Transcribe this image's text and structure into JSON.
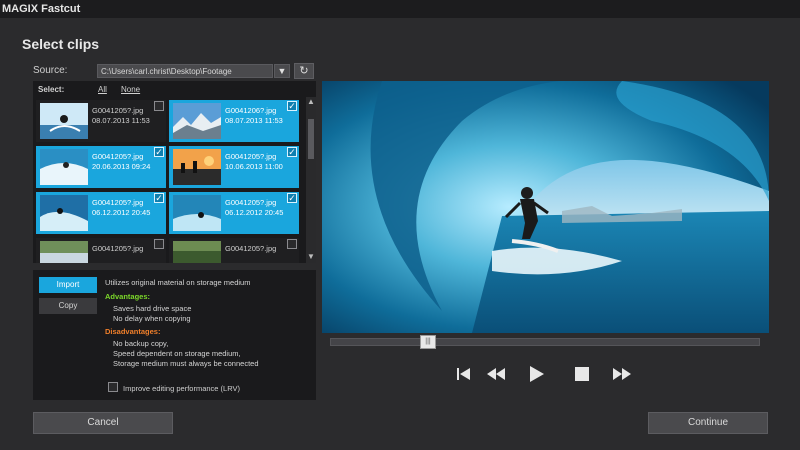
{
  "app": {
    "title": "MAGIX Fastcut"
  },
  "heading": "Select clips",
  "source": {
    "label": "Source:",
    "path": "C:\\Users\\carl.christ\\Desktop\\Footage",
    "dropdown_icon": "chevron-down-icon",
    "refresh_icon": "refresh-icon"
  },
  "select": {
    "label": "Select:",
    "all": "All",
    "none": "None"
  },
  "clips": [
    {
      "name": "G0041205?.jpg",
      "date": "08.07.2013 11:53",
      "selected": false
    },
    {
      "name": "G0041206?.jpg",
      "date": "08.07.2013 11:53",
      "selected": true
    },
    {
      "name": "G0041205?.jpg",
      "date": "20.06.2013 09:24",
      "selected": true
    },
    {
      "name": "G0041205?.jpg",
      "date": "10.06.2013 11:00",
      "selected": true
    },
    {
      "name": "G0041205?.jpg",
      "date": "06.12.2012 20:45",
      "selected": true
    },
    {
      "name": "G0041205?.jpg",
      "date": "06.12.2012 20:45",
      "selected": true
    },
    {
      "name": "G0041205?.jpg",
      "date": "",
      "selected": false
    },
    {
      "name": "G0041205?.jpg",
      "date": "",
      "selected": false
    }
  ],
  "mode": {
    "import": "Import",
    "copy": "Copy"
  },
  "info": {
    "line1": "Utilizes original material on storage medium",
    "advantages_head": "Advantages:",
    "adv1": "Saves hard drive space",
    "adv2": "No delay when copying",
    "disadvantages_head": "Disadvantages:",
    "dis1": "No backup copy,",
    "dis2": "Speed dependent on storage medium,",
    "dis3": "Storage medium must always be connected"
  },
  "lrv": {
    "label": "Improve editing performance (LRV)",
    "checked": false
  },
  "timeline": {
    "position": 0.12
  },
  "transport": {
    "icons": [
      "skip-to-start-icon",
      "rewind-icon",
      "play-icon",
      "stop-icon",
      "fast-forward-icon"
    ]
  },
  "buttons": {
    "cancel": "Cancel",
    "continue": "Continue"
  },
  "colors": {
    "accent": "#1aa6dd",
    "advantages": "#7cd82a",
    "disadvantages": "#f07f2a"
  }
}
